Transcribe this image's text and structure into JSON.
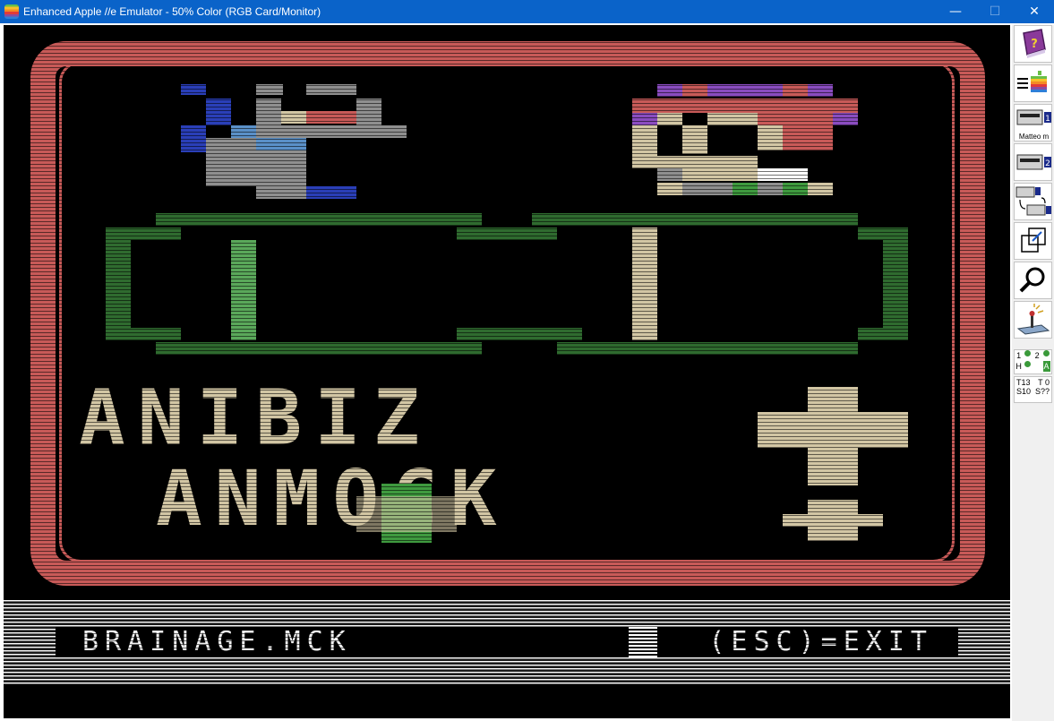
{
  "window": {
    "title": "Enhanced Apple //e Emulator -  50% Color (RGB Card/Monitor)",
    "minimize_glyph": "—",
    "maximize_glyph": "☐",
    "close_glyph": "✕"
  },
  "screen": {
    "status_left": "BRAINAGE.MCK",
    "status_right": "(ESC)=EXIT",
    "game_text_line1": "ANIBIZ",
    "game_text_line2": "ANMOCK"
  },
  "toolbar": {
    "buttons": [
      {
        "icon": "help-book-icon"
      },
      {
        "icon": "apple-menu-icon"
      },
      {
        "icon": "drive1-icon",
        "badge": "1",
        "sub": "Matteo m"
      },
      {
        "icon": "drive2-icon",
        "badge": "2"
      },
      {
        "icon": "swap-drives-icon"
      },
      {
        "icon": "fullscreen-icon"
      },
      {
        "icon": "debugger-magnifier-icon"
      },
      {
        "icon": "settings-joystick-icon"
      }
    ],
    "leds": {
      "d1": "1",
      "d2": "2",
      "h": "H",
      "a": "A"
    },
    "info": {
      "t13": "T13",
      "t0": "T 0",
      "s10": "S10",
      "sq": "S??"
    }
  },
  "colors": {
    "title_bar": "#0a63c9",
    "frame_red": "#c85a58",
    "tan": "#d2c6a4",
    "dark_green": "#2f6b2f",
    "gray": "#8f8f8f",
    "blue": "#2a3fb8"
  }
}
